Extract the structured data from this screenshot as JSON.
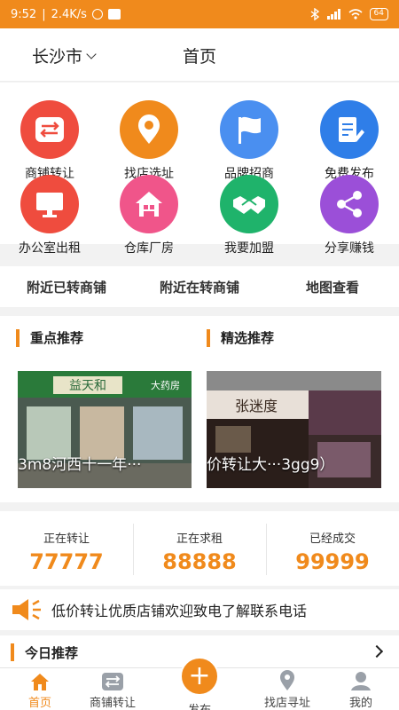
{
  "status_bar": {
    "time": "9:52",
    "speed": "2.4K/s",
    "battery": "64"
  },
  "header": {
    "city": "长沙市",
    "title": "首页"
  },
  "grid": [
    {
      "label": "商铺转让",
      "icon": "transfer-arrows-icon",
      "color": "#ef4c3e"
    },
    {
      "label": "找店选址",
      "icon": "location-pin-icon",
      "color": "#f08a1c"
    },
    {
      "label": "品牌招商",
      "icon": "flag-icon",
      "color": "#4a8ff0"
    },
    {
      "label": "免费发布",
      "icon": "document-edit-icon",
      "color": "#2f7ee8"
    },
    {
      "label": "办公室出租",
      "icon": "monitor-icon",
      "color": "#ef4c3e"
    },
    {
      "label": "仓库厂房",
      "icon": "house-icon",
      "color": "#f0558a"
    },
    {
      "label": "我要加盟",
      "icon": "handshake-icon",
      "color": "#1fb36b"
    },
    {
      "label": "分享赚钱",
      "icon": "share-icon",
      "color": "#9b4fd8"
    }
  ],
  "subnav": [
    "附近已转商铺",
    "附近在转商铺",
    "地图查看"
  ],
  "recommend": {
    "left_title": "重点推荐",
    "right_title": "精选推荐",
    "left_caption": "3m8河西十一年···",
    "right_caption": "价转让大···3gg9）",
    "left_sign": "益天和",
    "left_sign2": "大药房",
    "right_sign": "张迷度"
  },
  "stats": [
    {
      "label": "正在转让",
      "value": "77777"
    },
    {
      "label": "正在求租",
      "value": "88888"
    },
    {
      "label": "已经成交",
      "value": "99999"
    }
  ],
  "notice": {
    "text": "低价转让优质店铺欢迎致电了解联系电话"
  },
  "today": {
    "label": "今日推荐"
  },
  "tabbar": [
    {
      "label": "首页",
      "icon": "home-icon"
    },
    {
      "label": "商铺转让",
      "icon": "transfer-icon"
    },
    {
      "label": "发布",
      "icon": "plus-icon"
    },
    {
      "label": "找店寻址",
      "icon": "location-icon"
    },
    {
      "label": "我的",
      "icon": "user-icon"
    }
  ],
  "colors": {
    "accent": "#f08a1c"
  }
}
